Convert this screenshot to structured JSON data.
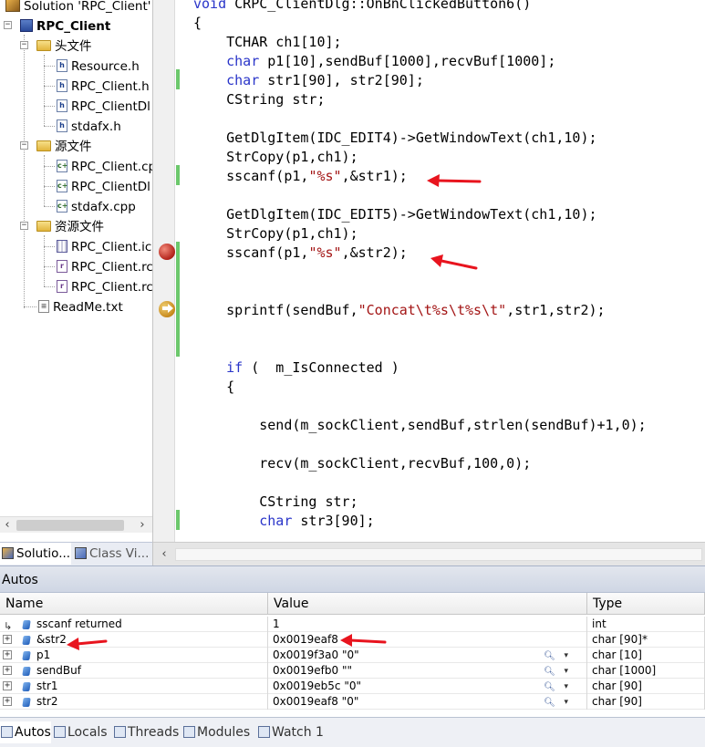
{
  "solution_explorer": {
    "items": [
      {
        "label": "Solution 'RPC_Client' (",
        "icon": "solution-icon"
      },
      {
        "label": "RPC_Client",
        "icon": "project-icon"
      },
      {
        "label": "头文件",
        "icon": "folder-icon"
      },
      {
        "label": "Resource.h",
        "icon": "header-file-icon"
      },
      {
        "label": "RPC_Client.h",
        "icon": "header-file-icon"
      },
      {
        "label": "RPC_ClientDl",
        "icon": "header-file-icon"
      },
      {
        "label": "stdafx.h",
        "icon": "header-file-icon"
      },
      {
        "label": "源文件",
        "icon": "folder-icon"
      },
      {
        "label": "RPC_Client.cp",
        "icon": "cpp-file-icon"
      },
      {
        "label": "RPC_ClientDl",
        "icon": "cpp-file-icon"
      },
      {
        "label": "stdafx.cpp",
        "icon": "cpp-file-icon"
      },
      {
        "label": "资源文件",
        "icon": "folder-icon"
      },
      {
        "label": "RPC_Client.ic",
        "icon": "icon-file-icon"
      },
      {
        "label": "RPC_Client.rc",
        "icon": "rc-file-icon"
      },
      {
        "label": "RPC_Client.rc",
        "icon": "rc-file-icon"
      },
      {
        "label": "ReadMe.txt",
        "icon": "text-file-icon"
      }
    ],
    "tabs": [
      {
        "label": "Solutio...",
        "icon": "solution-explorer-tab-icon"
      },
      {
        "label": "Class Vi...",
        "icon": "class-view-tab-icon"
      }
    ]
  },
  "editor": {
    "lines": [
      [
        {
          "t": "void",
          "c": "kw"
        },
        {
          "t": " CRPC_ClientDlg::OnBnClickedButton6()"
        }
      ],
      [
        {
          "t": "{"
        }
      ],
      [
        {
          "t": "    TCHAR ch1[10];"
        }
      ],
      [
        {
          "t": "    "
        },
        {
          "t": "char",
          "c": "kw"
        },
        {
          "t": " p1[10],sendBuf[1000],recvBuf[1000];"
        }
      ],
      [
        {
          "t": "    "
        },
        {
          "t": "char",
          "c": "kw"
        },
        {
          "t": " str1[90], str2[90];"
        }
      ],
      [
        {
          "t": "    CString str;"
        }
      ],
      [
        {
          "t": ""
        }
      ],
      [
        {
          "t": "    GetDlgItem(IDC_EDIT4)->GetWindowText(ch1,10);"
        }
      ],
      [
        {
          "t": "    StrCopy(p1,ch1);"
        }
      ],
      [
        {
          "t": "    sscanf(p1,"
        },
        {
          "t": "\"%s\"",
          "c": "str"
        },
        {
          "t": ",&str1);"
        }
      ],
      [
        {
          "t": ""
        }
      ],
      [
        {
          "t": "    GetDlgItem(IDC_EDIT5)->GetWindowText(ch1,10);"
        }
      ],
      [
        {
          "t": "    StrCopy(p1,ch1);"
        }
      ],
      [
        {
          "t": "    sscanf(p1,"
        },
        {
          "t": "\"%s\"",
          "c": "str"
        },
        {
          "t": ",&str2);"
        }
      ],
      [
        {
          "t": ""
        }
      ],
      [
        {
          "t": ""
        }
      ],
      [
        {
          "t": "    sprintf(sendBuf,"
        },
        {
          "t": "\"Concat\\t%s\\t%s\\t\"",
          "c": "str"
        },
        {
          "t": ",str1,str2);"
        }
      ],
      [
        {
          "t": ""
        }
      ],
      [
        {
          "t": ""
        }
      ],
      [
        {
          "t": "    "
        },
        {
          "t": "if",
          "c": "kw"
        },
        {
          "t": " (  m_IsConnected )"
        }
      ],
      [
        {
          "t": "    {"
        }
      ],
      [
        {
          "t": ""
        }
      ],
      [
        {
          "t": "        send(m_sockClient,sendBuf,strlen(sendBuf)+1,0);"
        }
      ],
      [
        {
          "t": ""
        }
      ],
      [
        {
          "t": "        recv(m_sockClient,recvBuf,100,0);"
        }
      ],
      [
        {
          "t": ""
        }
      ],
      [
        {
          "t": "        CString str;"
        }
      ],
      [
        {
          "t": "        "
        },
        {
          "t": "char",
          "c": "kw"
        },
        {
          "t": " str3[90];"
        }
      ]
    ]
  },
  "autos": {
    "title": "Autos",
    "columns": {
      "name": "Name",
      "value": "Value",
      "type": "Type"
    },
    "rows": [
      {
        "name": "sscanf returned",
        "value": "1",
        "type": "int"
      },
      {
        "name": "&str2",
        "value": "0x0019eaf8",
        "type": "char [90]*"
      },
      {
        "name": "p1",
        "value": "0x0019f3a0 \"0\"",
        "type": "char [10]"
      },
      {
        "name": "sendBuf",
        "value": "0x0019efb0 \"\"",
        "type": "char [1000]"
      },
      {
        "name": "str1",
        "value": "0x0019eb5c \"0\"",
        "type": "char [90]"
      },
      {
        "name": "str2",
        "value": "0x0019eaf8 \"0\"",
        "type": "char [90]"
      }
    ],
    "tabs": [
      {
        "label": "Autos"
      },
      {
        "label": "Locals"
      },
      {
        "label": "Threads"
      },
      {
        "label": "Modules"
      },
      {
        "label": "Watch 1"
      }
    ]
  },
  "colors": {
    "keyword": "#2a35c9",
    "string": "#a31515",
    "annotation_arrow": "#e8141e",
    "change_bar": "#6cc86c"
  }
}
